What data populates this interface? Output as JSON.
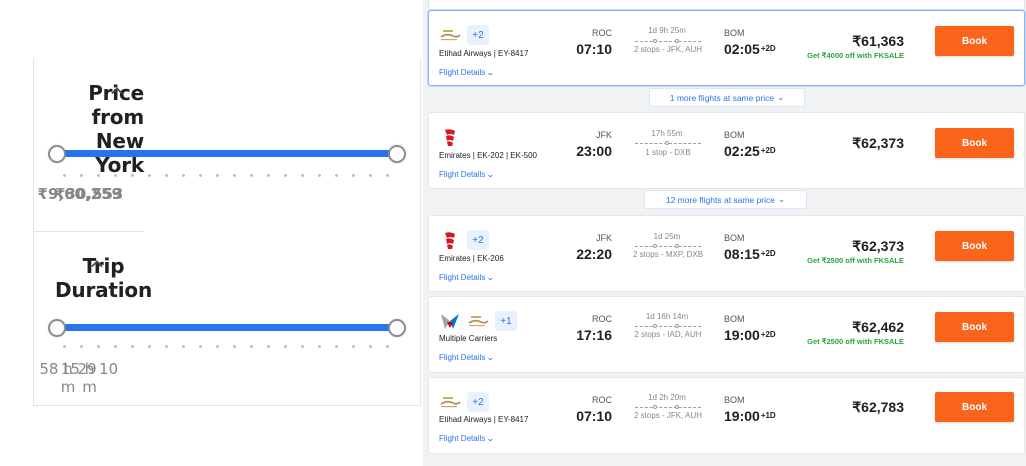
{
  "filters": {
    "price": {
      "title": "Price from New York",
      "min_label": "₹30,553",
      "max_label": "₹9,60,259",
      "range_low_fraction": 0,
      "range_high_fraction": 1
    },
    "duration": {
      "title": "Trip Duration",
      "min_label": "15 h 10 m",
      "max_label": "58 h 29 m",
      "range_low_fraction": 0,
      "range_high_fraction": 1
    }
  },
  "accent_color": "#2874f0",
  "book_color": "#fb641b",
  "offer_color": "#26a541",
  "flights": [
    {
      "logos": [
        "etihad-logo"
      ],
      "extra_carriers": "+2",
      "airline": "Etihad Airways | EY-8417",
      "details_link": "Flight Details",
      "dep_code": "ROC",
      "dep_time": "07:10",
      "duration": "1d 9h 25m",
      "stops": "2 stops - JFK, AUH",
      "arr_code": "BOM",
      "arr_time": "02:05",
      "arr_day": "+2D",
      "price": "₹61,363",
      "offer": "Get ₹4000 off with FKSALE",
      "book_label": "Book"
    },
    {
      "logos": [
        "emirates-logo"
      ],
      "extra_carriers": "",
      "airline": "Emirates | EK-202 | EK-500",
      "details_link": "Flight Details",
      "dep_code": "JFK",
      "dep_time": "23:00",
      "duration": "17h 55m",
      "stops": "1 stop - DXB",
      "arr_code": "BOM",
      "arr_time": "02:25",
      "arr_day": "+2D",
      "price": "₹62,373",
      "offer": "",
      "book_label": "Book"
    },
    {
      "logos": [
        "emirates-logo"
      ],
      "extra_carriers": "+2",
      "airline": "Emirates | EK-206",
      "details_link": "Flight Details",
      "dep_code": "JFK",
      "dep_time": "22:20",
      "duration": "1d 25m",
      "stops": "2 stops - MXP, DXB",
      "arr_code": "BOM",
      "arr_time": "08:15",
      "arr_day": "+2D",
      "price": "₹62,373",
      "offer": "Get ₹2500 off with FKSALE",
      "book_label": "Book"
    },
    {
      "logos": [
        "american-airlines-logo",
        "etihad-logo"
      ],
      "extra_carriers": "+1",
      "airline": "Multiple Carriers",
      "details_link": "Flight Details",
      "dep_code": "ROC",
      "dep_time": "17:16",
      "duration": "1d 16h 14m",
      "stops": "2 stops - IAD, AUH",
      "arr_code": "BOM",
      "arr_time": "19:00",
      "arr_day": "+2D",
      "price": "₹62,462",
      "offer": "Get ₹2500 off with FKSALE",
      "book_label": "Book"
    },
    {
      "logos": [
        "etihad-logo"
      ],
      "extra_carriers": "+2",
      "airline": "Etihad Airways | EY-8417",
      "details_link": "Flight Details",
      "dep_code": "ROC",
      "dep_time": "07:10",
      "duration": "1d 2h 20m",
      "stops": "2 stops - JFK, AUH",
      "arr_code": "BOM",
      "arr_time": "19:00",
      "arr_day": "+1D",
      "price": "₹62,783",
      "offer": "",
      "book_label": "Book"
    }
  ],
  "more_flights": [
    {
      "label": "1 more flights at same price"
    },
    {
      "label": "12 more flights at same price"
    }
  ]
}
